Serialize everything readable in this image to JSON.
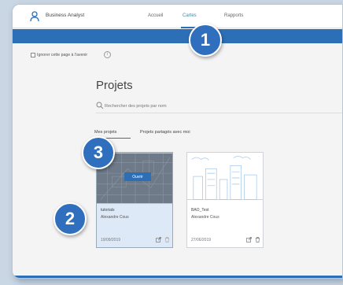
{
  "header": {
    "app_title": "Business Analyst",
    "nav": [
      {
        "label": "Accueil",
        "active": false
      },
      {
        "label": "Cartes",
        "active": true
      },
      {
        "label": "Rapports",
        "active": false
      }
    ]
  },
  "ignore_label": "Ignorer cette page à l'avenir",
  "page_title": "Projets",
  "search": {
    "placeholder": "Rechercher des projets par nom",
    "value": ""
  },
  "tabs": [
    "Mes projets",
    "Projets partagés avec moi"
  ],
  "cards": [
    {
      "name": "tutorials",
      "owner": "Alexandre Cous",
      "date": "19/09/2019",
      "open_label": "Ouvrir",
      "selected": true
    },
    {
      "name": "BAO_Test",
      "owner": "Alexandre Cous",
      "date": "27/06/2019",
      "selected": false
    }
  ],
  "badges": [
    "1",
    "2",
    "3"
  ],
  "colors": {
    "accent": "#2d6fb7",
    "badge": "#2f6fbd",
    "background": "#f4f4f4"
  }
}
